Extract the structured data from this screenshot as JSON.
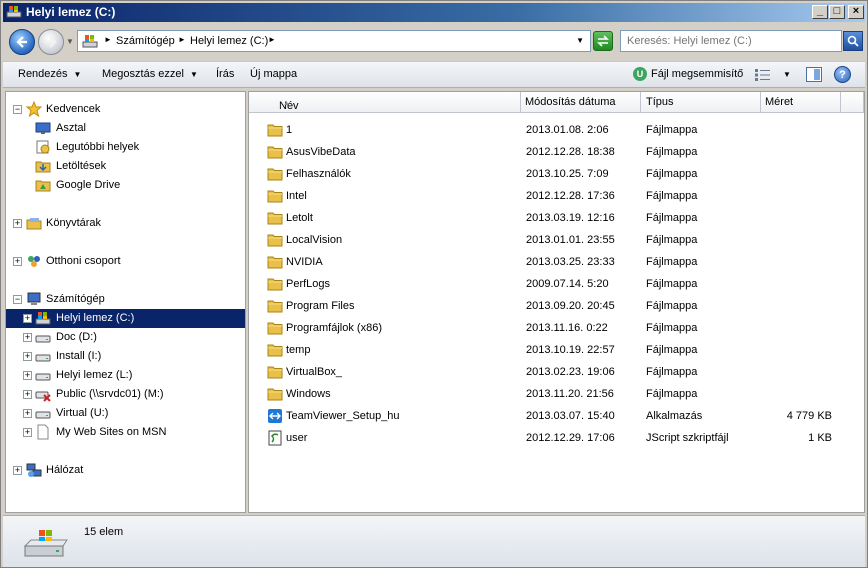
{
  "window": {
    "title": "Helyi lemez (C:)"
  },
  "address": {
    "crumbs": [
      "Számítógép",
      "Helyi lemez (C:)"
    ]
  },
  "search": {
    "placeholder": "Keresés: Helyi lemez (C:)"
  },
  "toolbar": {
    "organize": "Rendezés",
    "share": "Megosztás ezzel",
    "burn": "Írás",
    "new_folder": "Új mappa",
    "shredder": "Fájl megsemmisítő"
  },
  "nav": {
    "favorites": {
      "label": "Kedvencek",
      "items": [
        "Asztal",
        "Legutóbbi helyek",
        "Letöltések",
        "Google Drive"
      ]
    },
    "libraries": "Könyvtárak",
    "homegroup": "Otthoni csoport",
    "computer": {
      "label": "Számítógép",
      "drives": [
        "Helyi lemez (C:)",
        "Doc (D:)",
        "Install (I:)",
        "Helyi lemez (L:)",
        "Public (\\\\srvdc01) (M:)",
        "Virtual (U:)",
        "My Web Sites on MSN"
      ]
    },
    "network": "Hálózat"
  },
  "columns": [
    "Név",
    "Módosítás dátuma",
    "Típus",
    "Méret"
  ],
  "files": [
    {
      "name": "1",
      "date": "2013.01.08. 2:06",
      "type": "Fájlmappa",
      "size": "",
      "icon": "folder-icon"
    },
    {
      "name": "AsusVibeData",
      "date": "2012.12.28. 18:38",
      "type": "Fájlmappa",
      "size": "",
      "icon": "folder-icon"
    },
    {
      "name": "Felhasználók",
      "date": "2013.10.25. 7:09",
      "type": "Fájlmappa",
      "size": "",
      "icon": "folder-icon"
    },
    {
      "name": "Intel",
      "date": "2012.12.28. 17:36",
      "type": "Fájlmappa",
      "size": "",
      "icon": "folder-icon"
    },
    {
      "name": "Letolt",
      "date": "2013.03.19. 12:16",
      "type": "Fájlmappa",
      "size": "",
      "icon": "folder-icon"
    },
    {
      "name": "LocalVision",
      "date": "2013.01.01. 23:55",
      "type": "Fájlmappa",
      "size": "",
      "icon": "folder-icon"
    },
    {
      "name": "NVIDIA",
      "date": "2013.03.25. 23:33",
      "type": "Fájlmappa",
      "size": "",
      "icon": "folder-icon"
    },
    {
      "name": "PerfLogs",
      "date": "2009.07.14. 5:20",
      "type": "Fájlmappa",
      "size": "",
      "icon": "folder-icon"
    },
    {
      "name": "Program Files",
      "date": "2013.09.20. 20:45",
      "type": "Fájlmappa",
      "size": "",
      "icon": "folder-icon"
    },
    {
      "name": "Programfájlok (x86)",
      "date": "2013.11.16. 0:22",
      "type": "Fájlmappa",
      "size": "",
      "icon": "folder-icon"
    },
    {
      "name": "temp",
      "date": "2013.10.19. 22:57",
      "type": "Fájlmappa",
      "size": "",
      "icon": "folder-icon"
    },
    {
      "name": "VirtualBox_",
      "date": "2013.02.23. 19:06",
      "type": "Fájlmappa",
      "size": "",
      "icon": "folder-icon"
    },
    {
      "name": "Windows",
      "date": "2013.11.20. 21:56",
      "type": "Fájlmappa",
      "size": "",
      "icon": "folder-icon"
    },
    {
      "name": "TeamViewer_Setup_hu",
      "date": "2013.03.07. 15:40",
      "type": "Alkalmazás",
      "size": "4 779 KB",
      "icon": "teamviewer-icon"
    },
    {
      "name": "user",
      "date": "2012.12.29. 17:06",
      "type": "JScript szkriptfájl",
      "size": "1 KB",
      "icon": "script-icon"
    }
  ],
  "details": {
    "count": "15 elem"
  },
  "colors": {
    "selection": "#0a246a",
    "titlebar": "#0a246a",
    "folder": "#e8c04a"
  }
}
